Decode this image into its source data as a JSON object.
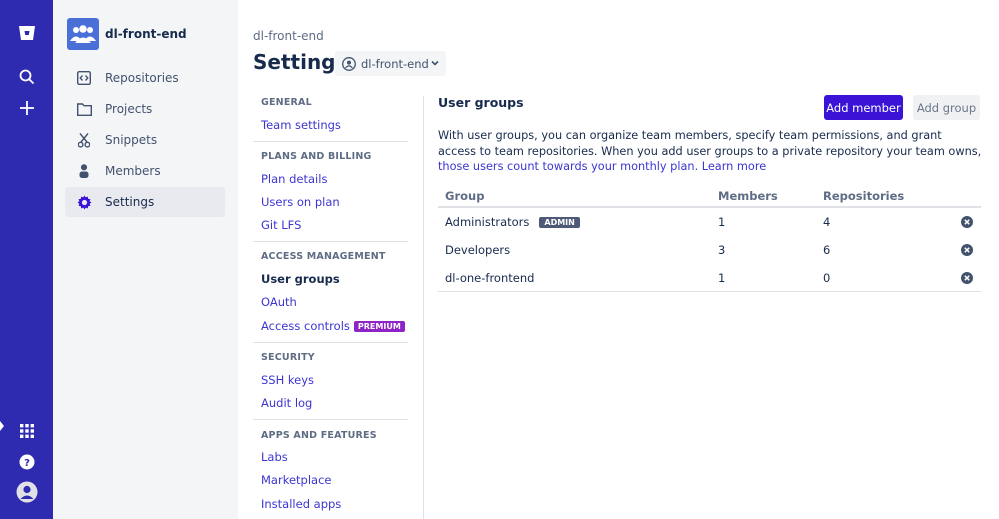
{
  "team": {
    "name": "dl-front-end"
  },
  "sidebar": {
    "items": [
      {
        "label": "Repositories",
        "icon": "code-icon"
      },
      {
        "label": "Projects",
        "icon": "folder-icon"
      },
      {
        "label": "Snippets",
        "icon": "scissors-icon"
      },
      {
        "label": "Members",
        "icon": "person-icon"
      },
      {
        "label": "Settings",
        "icon": "gear-icon"
      }
    ],
    "active_index": 4
  },
  "header": {
    "breadcrumb": "dl-front-end",
    "title": "Settings",
    "repo_select": "dl-front-end"
  },
  "settings_nav": {
    "sections": [
      {
        "title": "GENERAL",
        "links": [
          "Team settings"
        ]
      },
      {
        "title": "PLANS AND BILLING",
        "links": [
          "Plan details",
          "Users on plan",
          "Git LFS"
        ]
      },
      {
        "title": "ACCESS MANAGEMENT",
        "links": [
          "User groups",
          "OAuth",
          "Access controls"
        ],
        "badge": "PREMIUM"
      },
      {
        "title": "SECURITY",
        "links": [
          "SSH keys",
          "Audit log"
        ]
      },
      {
        "title": "APPS AND FEATURES",
        "links": [
          "Labs",
          "Marketplace",
          "Installed apps"
        ]
      }
    ],
    "current": "User groups"
  },
  "main": {
    "heading": "User groups",
    "add_member_label": "Add member",
    "add_group_label": "Add group",
    "description": "With user groups, you can organize team members, specify team permissions, and grant access to team repositories. When you add user groups to a private repository your team owns, ",
    "description_link": "those users count towards your monthly plan.",
    "learn_more": "Learn more",
    "table": {
      "columns": [
        "Group",
        "Members",
        "Repositories"
      ],
      "rows": [
        {
          "group": "Administrators",
          "badge": "ADMIN",
          "members": "1",
          "repositories": "4"
        },
        {
          "group": "Developers",
          "members": "3",
          "repositories": "6"
        },
        {
          "group": "dl-one-frontend",
          "members": "1",
          "repositories": "0"
        }
      ]
    }
  },
  "colors": {
    "global_nav": "#2f2bb0",
    "primary": "#3b13d6",
    "link": "#3c35d0",
    "premium": "#8e24c6"
  }
}
